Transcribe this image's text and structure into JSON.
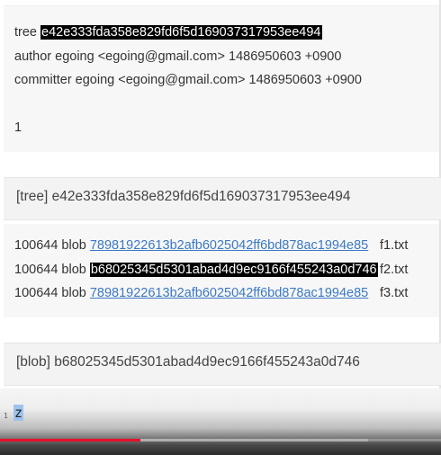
{
  "commit": {
    "tree_label": "tree",
    "tree_hash": "e42e333fda358e829fd6f5d169037317953ee494",
    "author_line": "author egoing <egoing@gmail.com> 1486950603 +0900",
    "committer_line": "committer egoing <egoing@gmail.com> 1486950603 +0900",
    "message": "1"
  },
  "tree_section": {
    "title": "[tree] e42e333fda358e829fd6f5d169037317953ee494",
    "entries": [
      {
        "mode_type": "100644 blob",
        "hash": "78981922613b2afb6025042ff6bd878ac1994e85",
        "filename": "f1.txt",
        "highlighted": false
      },
      {
        "mode_type": "100644 blob",
        "hash": "b68025345d5301abad4d9ec9166f455243a0d746",
        "filename": "f2.txt",
        "highlighted": true
      },
      {
        "mode_type": "100644 blob",
        "hash": "78981922613b2afb6025042ff6bd878ac1994e85",
        "filename": "f3.txt",
        "highlighted": false
      }
    ]
  },
  "blob_section": {
    "title": "[blob] b68025345d5301abad4d9ec9166f455243a0d746",
    "line_number": "1",
    "content": "z"
  },
  "video_progress": {
    "played_fraction": 0.318,
    "buffered_fraction": 0.835,
    "played_color": "#e8102a"
  }
}
